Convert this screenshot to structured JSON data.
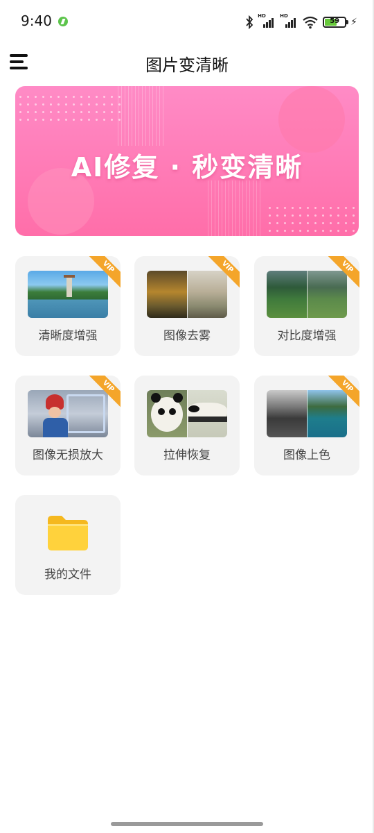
{
  "status_bar": {
    "time": "9:40",
    "battery": "59",
    "hd_label": "HD"
  },
  "header": {
    "title": "图片变清晰"
  },
  "banner": {
    "text": "AI修复 · 秒变清晰"
  },
  "vip_label": "VIP",
  "features": [
    {
      "label": "清晰度增强",
      "vip": true,
      "icon": "pagoda-lake-photo"
    },
    {
      "label": "图像去雾",
      "vip": true,
      "icon": "misty-forest-photo"
    },
    {
      "label": "对比度增强",
      "vip": true,
      "icon": "green-valley-photo"
    },
    {
      "label": "图像无损放大",
      "vip": true,
      "icon": "child-in-snow-photo"
    },
    {
      "label": "拉伸恢复",
      "vip": false,
      "icon": "panda-photo"
    },
    {
      "label": "图像上色",
      "vip": true,
      "icon": "lake-colorize-photo"
    },
    {
      "label": "我的文件",
      "vip": false,
      "icon": "folder-icon"
    }
  ],
  "colors": {
    "banner": "#ff77b4",
    "vip": "#f4a52a",
    "card": "#f3f3f3",
    "folder": "#ffcc33"
  }
}
